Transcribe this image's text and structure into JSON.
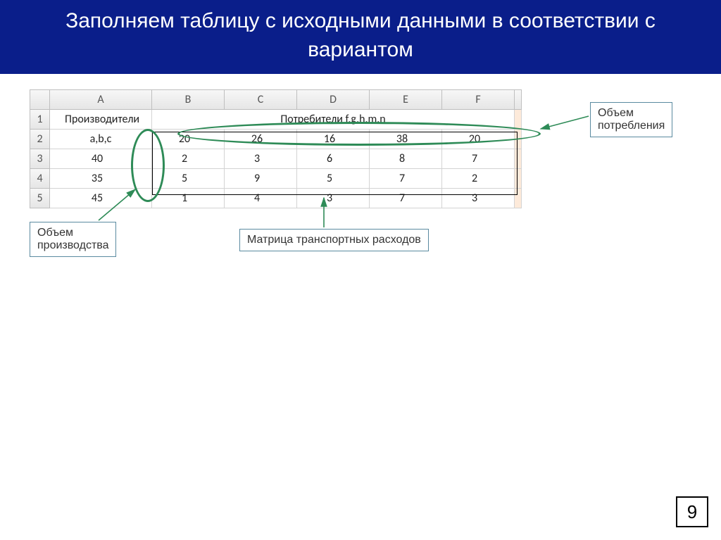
{
  "title": "Заполняем таблицу с исходными данными в соответствии с вариантом",
  "page_number": "9",
  "excel": {
    "cols": [
      "A",
      "B",
      "C",
      "D",
      "E",
      "F"
    ],
    "rows": [
      "1",
      "2",
      "3",
      "4",
      "5"
    ],
    "A1": "Производители",
    "B1_merged": "Потребители f,g,h,m,n",
    "A2": "a,b,c",
    "B2": "20",
    "C2": "26",
    "D2": "16",
    "E2": "38",
    "F2": "20",
    "A3": "40",
    "B3": "2",
    "C3": "3",
    "D3": "6",
    "E3": "8",
    "F3": "7",
    "A4": "35",
    "B4": "5",
    "C4": "9",
    "D4": "5",
    "E4": "7",
    "F4": "2",
    "A5": "45",
    "B5": "1",
    "C5": "4",
    "D5": "3",
    "E5": "7",
    "F5": "3"
  },
  "callouts": {
    "consumption": "Объем\nпотребления",
    "production": "Объем\nпроизводства",
    "matrix": "Матрица транспортных расходов"
  },
  "chart_data": {
    "type": "table",
    "title": "Transportation problem input data",
    "producers_label": "Производители a,b,c",
    "consumers_label": "Потребители f,g,h,m,n",
    "supply": [
      40,
      35,
      45
    ],
    "demand": [
      20,
      26,
      16,
      38,
      20
    ],
    "cost_matrix": [
      [
        2,
        3,
        6,
        8,
        7
      ],
      [
        5,
        9,
        5,
        7,
        2
      ],
      [
        1,
        4,
        3,
        7,
        3
      ]
    ]
  }
}
